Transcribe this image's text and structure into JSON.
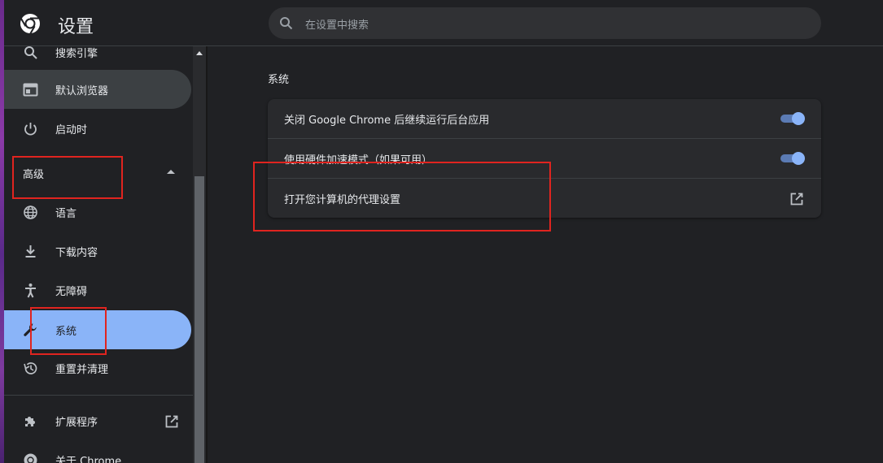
{
  "header": {
    "title": "设置",
    "search_placeholder": "在设置中搜索"
  },
  "sidebar": {
    "items": [
      {
        "label": "搜索引擎",
        "icon": "search-icon"
      },
      {
        "label": "默认浏览器",
        "icon": "browser-icon"
      },
      {
        "label": "启动时",
        "icon": "power-icon"
      },
      {
        "label": "语言",
        "icon": "globe-icon"
      },
      {
        "label": "下载内容",
        "icon": "download-icon"
      },
      {
        "label": "无障碍",
        "icon": "accessibility-icon"
      },
      {
        "label": "系统",
        "icon": "wrench-icon"
      },
      {
        "label": "重置并清理",
        "icon": "history-icon"
      },
      {
        "label": "扩展程序",
        "icon": "puzzle-icon"
      },
      {
        "label": "关于 Chrome",
        "icon": "chrome-icon"
      }
    ],
    "advanced_label": "高级",
    "active_item": "系统"
  },
  "main": {
    "section_title": "系统",
    "settings": [
      {
        "label": "关闭 Google Chrome 后继续运行后台应用",
        "control": "toggle",
        "enabled": true
      },
      {
        "label": "使用硬件加速模式（如果可用）",
        "control": "toggle",
        "enabled": true
      },
      {
        "label": "打开您计算机的代理设置",
        "control": "external-link"
      }
    ]
  },
  "colors": {
    "background": "#202124",
    "card": "#292a2d",
    "accent": "#8ab4f8",
    "annotation": "#e0241f"
  }
}
